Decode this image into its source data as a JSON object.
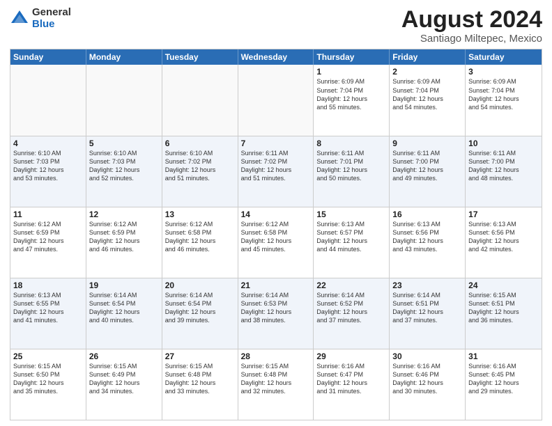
{
  "logo": {
    "general": "General",
    "blue": "Blue"
  },
  "title": "August 2024",
  "location": "Santiago Miltepec, Mexico",
  "days_of_week": [
    "Sunday",
    "Monday",
    "Tuesday",
    "Wednesday",
    "Thursday",
    "Friday",
    "Saturday"
  ],
  "weeks": [
    [
      {
        "day": "",
        "empty": true
      },
      {
        "day": "",
        "empty": true
      },
      {
        "day": "",
        "empty": true
      },
      {
        "day": "",
        "empty": true
      },
      {
        "day": "1",
        "info": "Sunrise: 6:09 AM\nSunset: 7:04 PM\nDaylight: 12 hours\nand 55 minutes."
      },
      {
        "day": "2",
        "info": "Sunrise: 6:09 AM\nSunset: 7:04 PM\nDaylight: 12 hours\nand 54 minutes."
      },
      {
        "day": "3",
        "info": "Sunrise: 6:09 AM\nSunset: 7:04 PM\nDaylight: 12 hours\nand 54 minutes."
      }
    ],
    [
      {
        "day": "4",
        "info": "Sunrise: 6:10 AM\nSunset: 7:03 PM\nDaylight: 12 hours\nand 53 minutes."
      },
      {
        "day": "5",
        "info": "Sunrise: 6:10 AM\nSunset: 7:03 PM\nDaylight: 12 hours\nand 52 minutes."
      },
      {
        "day": "6",
        "info": "Sunrise: 6:10 AM\nSunset: 7:02 PM\nDaylight: 12 hours\nand 51 minutes."
      },
      {
        "day": "7",
        "info": "Sunrise: 6:11 AM\nSunset: 7:02 PM\nDaylight: 12 hours\nand 51 minutes."
      },
      {
        "day": "8",
        "info": "Sunrise: 6:11 AM\nSunset: 7:01 PM\nDaylight: 12 hours\nand 50 minutes."
      },
      {
        "day": "9",
        "info": "Sunrise: 6:11 AM\nSunset: 7:00 PM\nDaylight: 12 hours\nand 49 minutes."
      },
      {
        "day": "10",
        "info": "Sunrise: 6:11 AM\nSunset: 7:00 PM\nDaylight: 12 hours\nand 48 minutes."
      }
    ],
    [
      {
        "day": "11",
        "info": "Sunrise: 6:12 AM\nSunset: 6:59 PM\nDaylight: 12 hours\nand 47 minutes."
      },
      {
        "day": "12",
        "info": "Sunrise: 6:12 AM\nSunset: 6:59 PM\nDaylight: 12 hours\nand 46 minutes."
      },
      {
        "day": "13",
        "info": "Sunrise: 6:12 AM\nSunset: 6:58 PM\nDaylight: 12 hours\nand 46 minutes."
      },
      {
        "day": "14",
        "info": "Sunrise: 6:12 AM\nSunset: 6:58 PM\nDaylight: 12 hours\nand 45 minutes."
      },
      {
        "day": "15",
        "info": "Sunrise: 6:13 AM\nSunset: 6:57 PM\nDaylight: 12 hours\nand 44 minutes."
      },
      {
        "day": "16",
        "info": "Sunrise: 6:13 AM\nSunset: 6:56 PM\nDaylight: 12 hours\nand 43 minutes."
      },
      {
        "day": "17",
        "info": "Sunrise: 6:13 AM\nSunset: 6:56 PM\nDaylight: 12 hours\nand 42 minutes."
      }
    ],
    [
      {
        "day": "18",
        "info": "Sunrise: 6:13 AM\nSunset: 6:55 PM\nDaylight: 12 hours\nand 41 minutes."
      },
      {
        "day": "19",
        "info": "Sunrise: 6:14 AM\nSunset: 6:54 PM\nDaylight: 12 hours\nand 40 minutes."
      },
      {
        "day": "20",
        "info": "Sunrise: 6:14 AM\nSunset: 6:54 PM\nDaylight: 12 hours\nand 39 minutes."
      },
      {
        "day": "21",
        "info": "Sunrise: 6:14 AM\nSunset: 6:53 PM\nDaylight: 12 hours\nand 38 minutes."
      },
      {
        "day": "22",
        "info": "Sunrise: 6:14 AM\nSunset: 6:52 PM\nDaylight: 12 hours\nand 37 minutes."
      },
      {
        "day": "23",
        "info": "Sunrise: 6:14 AM\nSunset: 6:51 PM\nDaylight: 12 hours\nand 37 minutes."
      },
      {
        "day": "24",
        "info": "Sunrise: 6:15 AM\nSunset: 6:51 PM\nDaylight: 12 hours\nand 36 minutes."
      }
    ],
    [
      {
        "day": "25",
        "info": "Sunrise: 6:15 AM\nSunset: 6:50 PM\nDaylight: 12 hours\nand 35 minutes."
      },
      {
        "day": "26",
        "info": "Sunrise: 6:15 AM\nSunset: 6:49 PM\nDaylight: 12 hours\nand 34 minutes."
      },
      {
        "day": "27",
        "info": "Sunrise: 6:15 AM\nSunset: 6:48 PM\nDaylight: 12 hours\nand 33 minutes."
      },
      {
        "day": "28",
        "info": "Sunrise: 6:15 AM\nSunset: 6:48 PM\nDaylight: 12 hours\nand 32 minutes."
      },
      {
        "day": "29",
        "info": "Sunrise: 6:16 AM\nSunset: 6:47 PM\nDaylight: 12 hours\nand 31 minutes."
      },
      {
        "day": "30",
        "info": "Sunrise: 6:16 AM\nSunset: 6:46 PM\nDaylight: 12 hours\nand 30 minutes."
      },
      {
        "day": "31",
        "info": "Sunrise: 6:16 AM\nSunset: 6:45 PM\nDaylight: 12 hours\nand 29 minutes."
      }
    ]
  ]
}
